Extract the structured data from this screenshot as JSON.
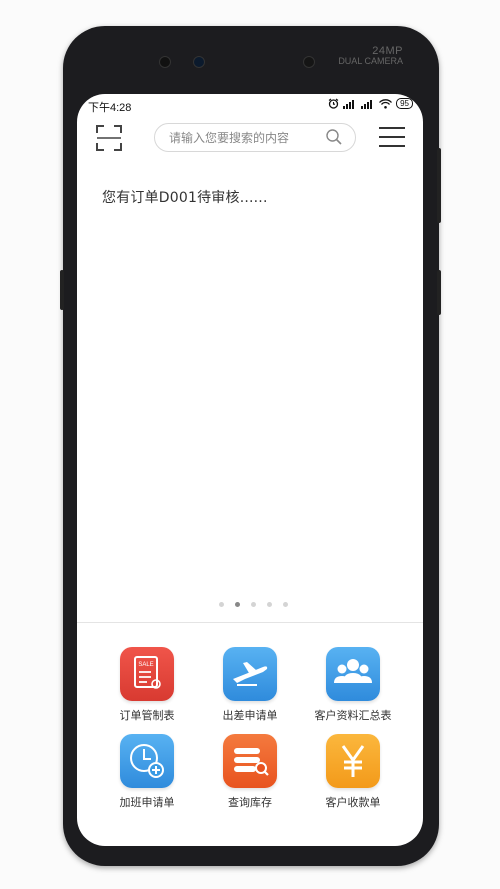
{
  "status_bar": {
    "time": "下午4:28",
    "battery": "95"
  },
  "device": {
    "camera_label_line1": "24MP",
    "camera_label_line2": "DUAL CAMERA"
  },
  "header": {
    "search_placeholder": "请输入您要搜索的内容"
  },
  "notice": {
    "text": "您有订单D001待审核......"
  },
  "carousel": {
    "total_pages": 5,
    "active_index": 1
  },
  "menu": {
    "items": [
      {
        "label": "订单管制表",
        "icon": "sale-document-icon",
        "color": "#e8453c"
      },
      {
        "label": "出差申请单",
        "icon": "airplane-icon",
        "color": "#3a9be4"
      },
      {
        "label": "客户资料汇总表",
        "icon": "people-group-icon",
        "color": "#3a9be4"
      },
      {
        "label": "加班申请单",
        "icon": "clock-plus-icon",
        "color": "#3a9be4"
      },
      {
        "label": "查询库存",
        "icon": "stock-search-icon",
        "color": "#f0642b"
      },
      {
        "label": "客户收款单",
        "icon": "yen-icon",
        "color": "#f7a825"
      }
    ]
  }
}
